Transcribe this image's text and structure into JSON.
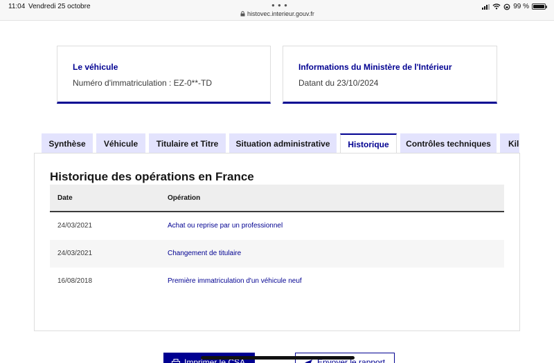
{
  "status_bar": {
    "time": "11:04",
    "date": "Vendredi 25 octobre",
    "url": "histovec.interieur.gouv.fr",
    "battery": "99 %",
    "battery_level": 0.99
  },
  "vehicle_card": {
    "title": "Le véhicule",
    "text": "Numéro d'immatriculation : EZ-0**-TD"
  },
  "ministry_card": {
    "title": "Informations du Ministère de l'Intérieur",
    "text": "Datant du 23/10/2024"
  },
  "tabs": [
    {
      "label": "Synthèse",
      "active": false
    },
    {
      "label": "Véhicule",
      "active": false
    },
    {
      "label": "Titulaire et Titre",
      "active": false
    },
    {
      "label": "Situation administrative",
      "active": false
    },
    {
      "label": "Historique",
      "active": true
    },
    {
      "label": "Contrôles techniques",
      "active": false
    },
    {
      "label": "Kilométrage",
      "active": false
    }
  ],
  "history": {
    "title": "Historique des opérations en France",
    "columns": [
      "Date",
      "Opération"
    ],
    "rows": [
      {
        "date": "24/03/2021",
        "operation": "Achat ou reprise par un professionnel"
      },
      {
        "date": "24/03/2021",
        "operation": "Changement de titulaire"
      },
      {
        "date": "16/08/2018",
        "operation": "Première immatriculation d'un véhicule neuf"
      }
    ]
  },
  "actions": {
    "print_label": "Imprimer le CSA",
    "send_label": "Envoyer le rapport"
  },
  "colors": {
    "accent": "#000091",
    "tab_inactive_bg": "#e3e3fd"
  }
}
